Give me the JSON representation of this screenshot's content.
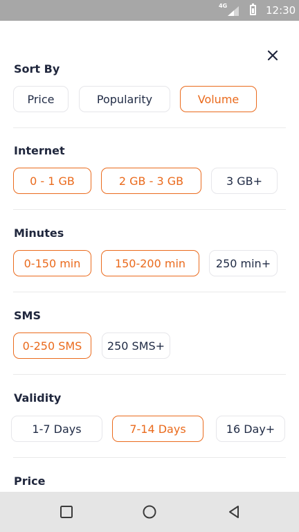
{
  "status_bar": {
    "network": "4G",
    "time": "12:30"
  },
  "filters": {
    "sort_by": {
      "title": "Sort By",
      "options": [
        "Price",
        "Popularity",
        "Volume"
      ],
      "selected": [
        "Volume"
      ]
    },
    "internet": {
      "title": "Internet",
      "options": [
        "0 - 1 GB",
        "2 GB - 3 GB",
        "3 GB+"
      ],
      "selected": [
        "0 - 1 GB",
        "2 GB - 3 GB"
      ]
    },
    "minutes": {
      "title": "Minutes",
      "options": [
        "0-150 min",
        "150-200 min",
        "250 min+"
      ],
      "selected": [
        "0-150 min",
        "150-200 min"
      ]
    },
    "sms": {
      "title": "SMS",
      "options": [
        "0-250 SMS",
        "250 SMS+"
      ],
      "selected": [
        "0-250 SMS"
      ]
    },
    "validity": {
      "title": "Validity",
      "options": [
        "1-7 Days",
        "7-14 Days",
        "16 Day+"
      ],
      "selected": [
        "7-14 Days"
      ]
    },
    "price": {
      "title": "Price"
    }
  },
  "colors": {
    "accent": "#ea6a1c",
    "text": "#1f2a44",
    "chip_border": "#e6e6ea",
    "status_bar": "#a7a7a7",
    "nav_bar": "#e5e5e5"
  },
  "icons": {
    "close": "close-icon",
    "nav": [
      "recent-apps-icon",
      "home-icon",
      "back-icon"
    ]
  }
}
